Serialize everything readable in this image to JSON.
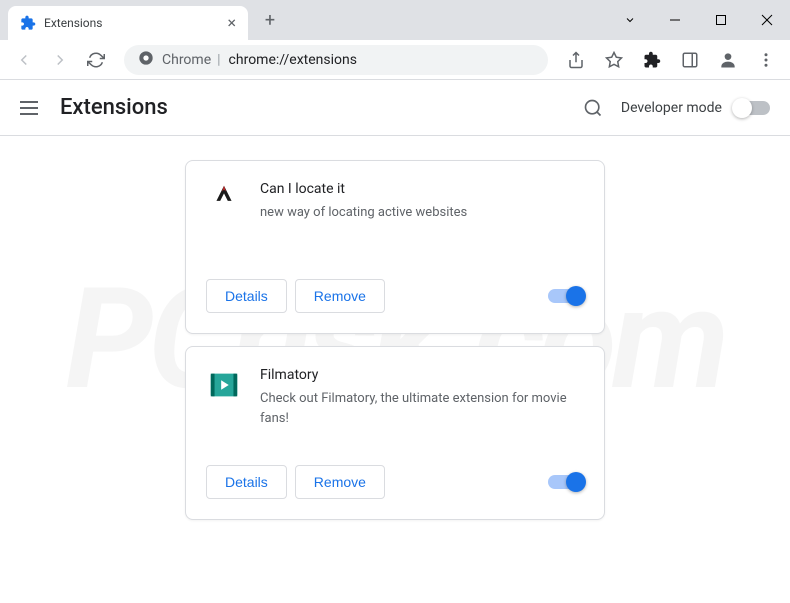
{
  "window": {
    "tab_title": "Extensions"
  },
  "address": {
    "origin": "Chrome",
    "path": "chrome://extensions"
  },
  "header": {
    "title": "Extensions",
    "dev_mode_label": "Developer mode",
    "dev_mode_enabled": false
  },
  "extensions": [
    {
      "name": "Can I locate it",
      "description": "new way of locating active websites",
      "details_label": "Details",
      "remove_label": "Remove",
      "enabled": true,
      "icon_style": "bird"
    },
    {
      "name": "Filmatory",
      "description": "Check out Filmatory, the ultimate extension for movie fans!",
      "details_label": "Details",
      "remove_label": "Remove",
      "enabled": true,
      "icon_style": "film"
    }
  ],
  "watermark": "PCrisk.com"
}
